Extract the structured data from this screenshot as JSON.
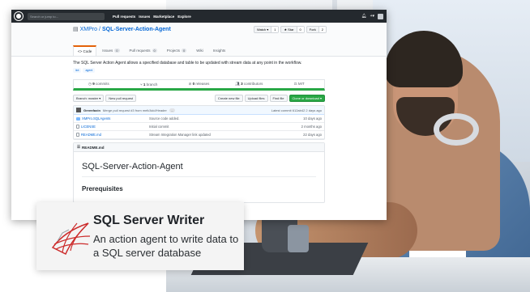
{
  "header": {
    "search_placeholder": "Search or jump to...",
    "nav": [
      "Pull requests",
      "Issues",
      "Marketplace",
      "Explore"
    ],
    "right_icons": [
      "bell-icon",
      "plus-icon"
    ]
  },
  "repo": {
    "owner": "XMPro",
    "separator": "/",
    "name": "SQL-Server-Action-Agent",
    "watch": {
      "label": "Watch ▾",
      "count": "1"
    },
    "star": {
      "label": "★ Star",
      "count": "0"
    },
    "fork": {
      "label": "Fork",
      "count": "2"
    },
    "tabs": [
      {
        "label": "<> Code",
        "count": ""
      },
      {
        "label": "Issues",
        "count": "0"
      },
      {
        "label": "Pull requests",
        "count": "0"
      },
      {
        "label": "Projects",
        "count": "0"
      },
      {
        "label": "Wiki",
        "count": ""
      },
      {
        "label": "Insights",
        "count": ""
      }
    ],
    "description": "The SQL Server Action Agent allows a specified database and table to be updated with stream data at any point in the workflow.",
    "topics": [
      "iiot",
      "agent"
    ],
    "stats": [
      {
        "value": "9",
        "label": "commits"
      },
      {
        "value": "1",
        "label": "branch"
      },
      {
        "value": "0",
        "label": "releases"
      },
      {
        "value": "3",
        "contributors_label": "contributors",
        "label": "contributors"
      },
      {
        "value": "",
        "label": "MIT"
      }
    ],
    "branch_label": "Branch: master ▾",
    "new_pr": "New pull request",
    "create_file": "Create new file",
    "upload_files": "Upload files",
    "find_file": "Find file",
    "clone": "Clone or download ▾",
    "commit": {
      "author": "Greenfaxin",
      "message": "Merge pull request #3 from melt/Add/Header",
      "more": "...",
      "latest": "Latest commit 612ab42 2 days ago"
    },
    "files": [
      {
        "name": "XMPro.SQLAgents",
        "type": "folder",
        "msg": "Source code added.",
        "age": "10 days ago"
      },
      {
        "name": "LICENSE",
        "type": "file",
        "msg": "Initial commit",
        "age": "2 months ago"
      },
      {
        "name": "README.md",
        "type": "file",
        "msg": "Stream Integration Manager link updated",
        "age": "22 days ago"
      }
    ],
    "readme_label": "README.md",
    "readme_h1": "SQL-Server-Action-Agent",
    "readme_h2": "Prerequisites"
  },
  "card": {
    "title": "SQL Server Writer",
    "subtitle": "An action agent to write data to a SQL server database",
    "icon": "sql-server-logo-icon",
    "icon_color": "#cc2b2b"
  }
}
